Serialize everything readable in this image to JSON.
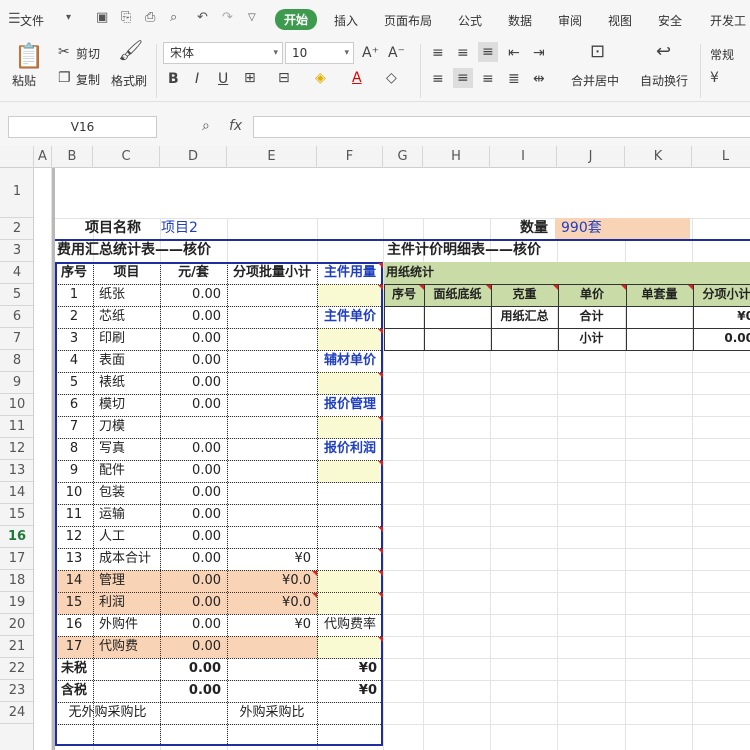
{
  "menubar": {
    "file": "文件",
    "items": [
      "开始",
      "插入",
      "页面布局",
      "公式",
      "数据",
      "审阅",
      "视图",
      "安全",
      "开发工"
    ]
  },
  "ribbon": {
    "paste": "粘贴",
    "cut": "剪切",
    "copy": "复制",
    "format_painter": "格式刷",
    "font": "宋体",
    "size": "10",
    "merge": "合并居中",
    "wrap": "自动换行",
    "numfmt": "常规"
  },
  "namebox": "V16",
  "fx": "fx",
  "columns": [
    "A",
    "B",
    "C",
    "D",
    "E",
    "F",
    "G",
    "H",
    "I",
    "J",
    "K",
    "L"
  ],
  "rows": [
    "1",
    "2",
    "3",
    "4",
    "5",
    "6",
    "7",
    "8",
    "9",
    "10",
    "11",
    "12",
    "13",
    "14",
    "15",
    "16",
    "17",
    "18",
    "19",
    "20",
    "21",
    "22",
    "23",
    "24"
  ],
  "sheet": {
    "project_label": "项目名称",
    "project_value": "项目2",
    "qty_label": "数量",
    "qty_value": "990套",
    "left_title": "费用汇总统计表——核价",
    "right_title": "主件计价明细表——核价",
    "headers": [
      "序号",
      "项目",
      "元/套",
      "分项批量小计",
      "主件用量"
    ],
    "items": [
      {
        "no": "1",
        "name": "纸张",
        "price": "0.00",
        "sub": "",
        "f": ""
      },
      {
        "no": "2",
        "name": "芯纸",
        "price": "0.00",
        "sub": "",
        "f": "主件单价"
      },
      {
        "no": "3",
        "name": "印刷",
        "price": "0.00",
        "sub": "",
        "f": ""
      },
      {
        "no": "4",
        "name": "表面",
        "price": "0.00",
        "sub": "",
        "f": "辅材单价"
      },
      {
        "no": "5",
        "name": "裱纸",
        "price": "0.00",
        "sub": "",
        "f": ""
      },
      {
        "no": "6",
        "name": "模切",
        "price": "0.00",
        "sub": "",
        "f": "报价管理"
      },
      {
        "no": "7",
        "name": "刀模",
        "price": "",
        "sub": "",
        "f": ""
      },
      {
        "no": "8",
        "name": "写真",
        "price": "0.00",
        "sub": "",
        "f": "报价利润"
      },
      {
        "no": "9",
        "name": "配件",
        "price": "0.00",
        "sub": "",
        "f": ""
      },
      {
        "no": "10",
        "name": "包装",
        "price": "0.00",
        "sub": "",
        "f": ""
      },
      {
        "no": "11",
        "name": "运输",
        "price": "0.00",
        "sub": "",
        "f": ""
      },
      {
        "no": "12",
        "name": "人工",
        "price": "0.00",
        "sub": "",
        "f": ""
      },
      {
        "no": "13",
        "name": "成本合计",
        "price": "0.00",
        "sub": "¥0",
        "f": ""
      },
      {
        "no": "14",
        "name": "管理",
        "price": "0.00",
        "sub": "¥0.0",
        "f": ""
      },
      {
        "no": "15",
        "name": "利润",
        "price": "0.00",
        "sub": "¥0.0",
        "f": ""
      },
      {
        "no": "16",
        "name": "外购件",
        "price": "0.00",
        "sub": "¥0",
        "f": "代购费率"
      },
      {
        "no": "17",
        "name": "代购费",
        "price": "0.00",
        "sub": "",
        "f": ""
      }
    ],
    "pretax_label": "未税",
    "pretax_value": "0.00",
    "pretax_sub": "¥0",
    "tax_label": "含税",
    "tax_value": "0.00",
    "tax_sub": "¥0",
    "no_outsource": "无外购采购比",
    "outsource": "外购采购比",
    "paper_stats": "用纸统计",
    "right_headers": [
      "序号",
      "面纸底纸",
      "克重",
      "单价",
      "单套量",
      "分项小计"
    ],
    "paper_total": "用纸汇总",
    "total": "合计",
    "total_val": "¥0",
    "subtotal": "小计",
    "subtotal_val": "0.00"
  }
}
